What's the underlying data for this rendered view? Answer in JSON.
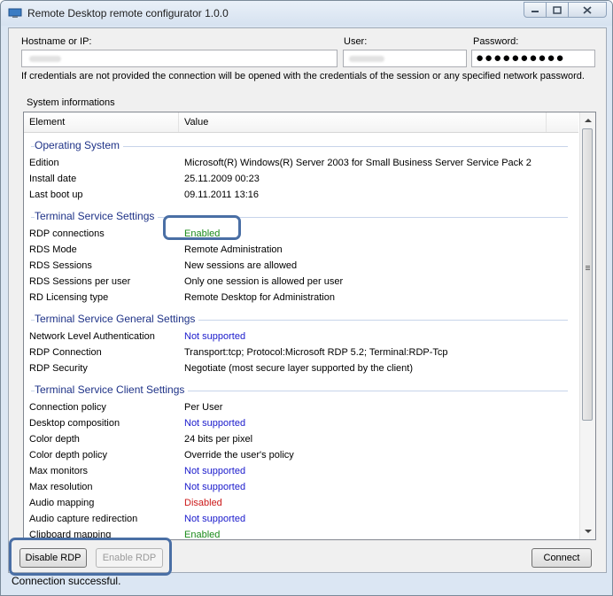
{
  "window": {
    "title": "Remote Desktop remote configurator 1.0.0"
  },
  "credentials": {
    "hostname_label": "Hostname or IP:",
    "user_label": "User:",
    "password_label": "Password:",
    "password_mask": "●●●●●●●●●●",
    "note": "If credentials are not provided the connection will be opened with the credentials of the session or any specified network password."
  },
  "system_info": {
    "label": "System informations",
    "columns": [
      "Element",
      "Value"
    ],
    "groups": [
      {
        "title": "Operating System",
        "rows": [
          {
            "element": "Edition",
            "value": "Microsoft(R) Windows(R) Server 2003 for Small Business Server Service Pack 2",
            "color": ""
          },
          {
            "element": "Install date",
            "value": "25.11.2009 00:23",
            "color": ""
          },
          {
            "element": "Last boot up",
            "value": "09.11.2011 13:16",
            "color": ""
          }
        ]
      },
      {
        "title": "Terminal Service Settings",
        "rows": [
          {
            "element": "RDP connections",
            "value": "Enabled",
            "color": "green"
          },
          {
            "element": "RDS Mode",
            "value": "Remote Administration",
            "color": ""
          },
          {
            "element": "RDS Sessions",
            "value": "New sessions are allowed",
            "color": ""
          },
          {
            "element": "RDS Sessions per user",
            "value": "Only one session is allowed per user",
            "color": ""
          },
          {
            "element": "RD Licensing type",
            "value": "Remote Desktop for Administration",
            "color": ""
          }
        ]
      },
      {
        "title": "Terminal Service General Settings",
        "rows": [
          {
            "element": "Network Level Authentication",
            "value": "Not supported",
            "color": "blue"
          },
          {
            "element": "RDP Connection",
            "value": "Transport:tcp; Protocol:Microsoft RDP 5.2; Terminal:RDP-Tcp",
            "color": ""
          },
          {
            "element": "RDP Security",
            "value": "Negotiate (most secure layer supported by the client)",
            "color": ""
          }
        ]
      },
      {
        "title": "Terminal Service Client Settings",
        "rows": [
          {
            "element": "Connection policy",
            "value": "Per User",
            "color": ""
          },
          {
            "element": "Desktop composition",
            "value": "Not supported",
            "color": "blue"
          },
          {
            "element": "Color depth",
            "value": "24 bits per pixel",
            "color": ""
          },
          {
            "element": "Color depth policy",
            "value": "Override the user's policy",
            "color": ""
          },
          {
            "element": "Max monitors",
            "value": "Not supported",
            "color": "blue"
          },
          {
            "element": "Max resolution",
            "value": "Not supported",
            "color": "blue"
          },
          {
            "element": "Audio mapping",
            "value": "Disabled",
            "color": "red"
          },
          {
            "element": "Audio capture redirection",
            "value": "Not supported",
            "color": "blue"
          },
          {
            "element": "Clipboard mapping",
            "value": "Enabled",
            "color": "green"
          }
        ]
      }
    ]
  },
  "buttons": {
    "disable_rdp": "Disable RDP",
    "enable_rdp": "Enable RDP",
    "connect": "Connect"
  },
  "status": "Connection successful.",
  "colors": {
    "enabled": "#1a8a1a",
    "not_supported": "#1a1acc",
    "disabled": "#cc1a1a",
    "group_title": "#1e3287",
    "highlight": "#4a6fa5"
  }
}
